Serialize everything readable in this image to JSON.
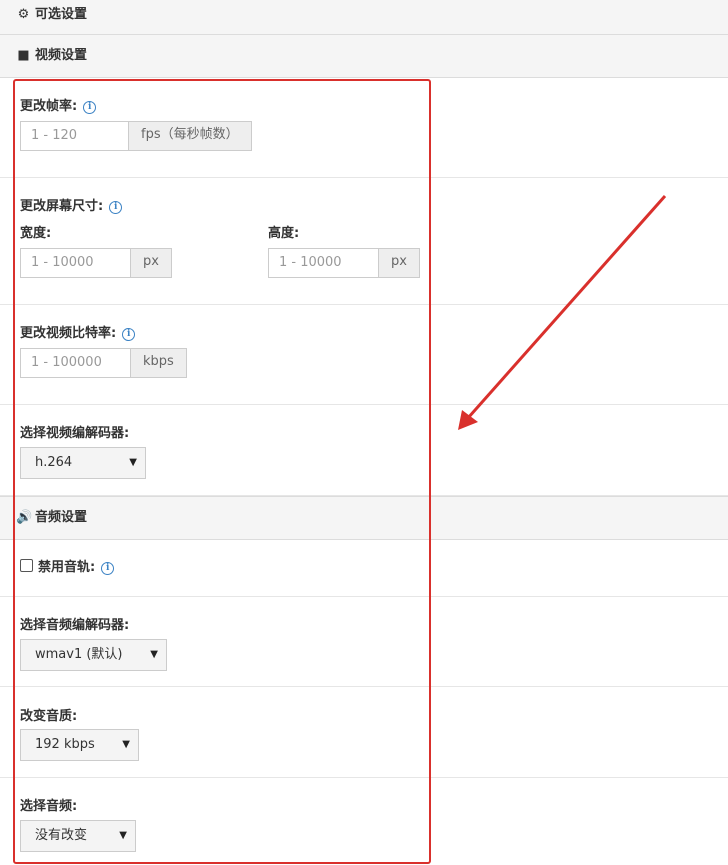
{
  "header": {
    "optional_icon": "gears-icon",
    "optional_title": "可选设置",
    "video_icon": "video-camera-icon",
    "video_title": "视频设置",
    "audio_icon": "speaker-icon",
    "audio_title": "音频设置"
  },
  "video": {
    "framerate_label": "更改帧率:",
    "framerate_placeholder": "1 - 120",
    "framerate_addon": "fps（每秒帧数）",
    "screen_label": "更改屏幕尺寸:",
    "width_label": "宽度:",
    "width_placeholder": "1 - 10000",
    "width_addon": "px",
    "height_label": "高度:",
    "height_placeholder": "1 - 10000",
    "height_addon": "px",
    "bitrate_label": "更改视频比特率:",
    "bitrate_placeholder": "1 - 100000",
    "bitrate_addon": "kbps",
    "codec_label": "选择视频编解码器:",
    "codec_value": "h.264"
  },
  "audio": {
    "disable_label": "禁用音轨:",
    "codec_label": "选择音频编解码器:",
    "codec_value": "wmav1 (默认)",
    "quality_label": "改变音质:",
    "quality_value": "192 kbps",
    "channel_label": "选择音频:",
    "channel_value": "没有改变"
  },
  "colors": {
    "highlight": "#d9302c",
    "info": "#3b82c4"
  }
}
